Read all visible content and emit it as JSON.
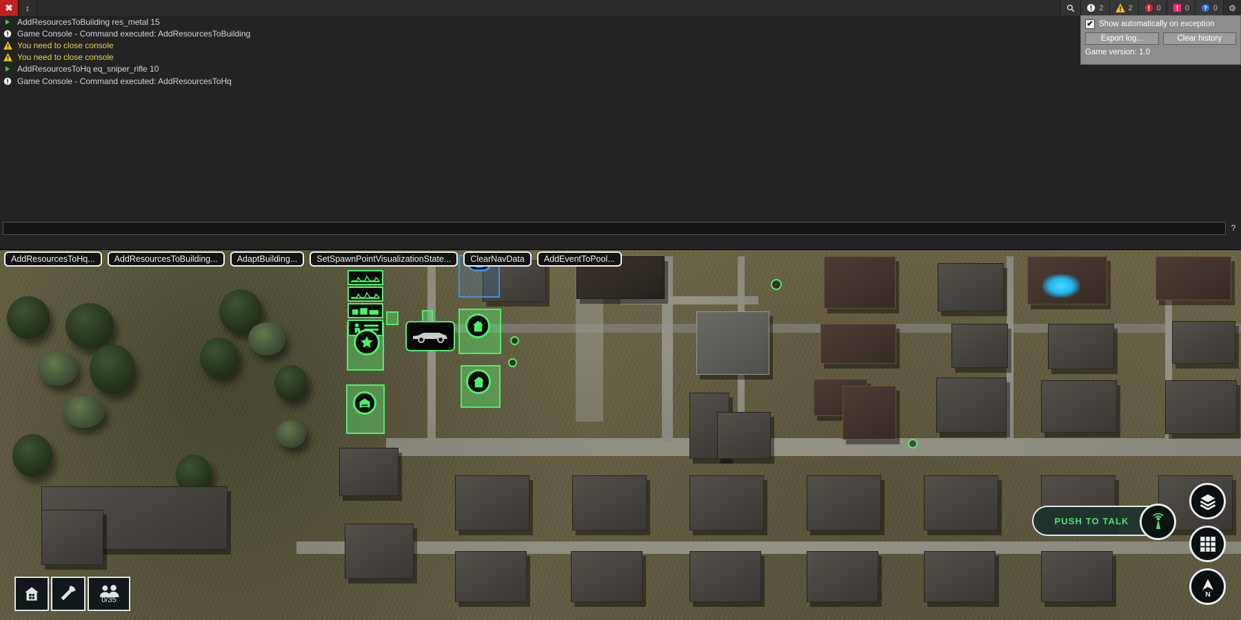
{
  "window": {
    "close_label": "✖",
    "resize_label": "↕",
    "gear_label": "⚙"
  },
  "toolbar": {
    "badges": [
      {
        "name": "search",
        "icon": "search-icon",
        "count": ""
      },
      {
        "name": "info",
        "icon": "info-icon",
        "count": "2"
      },
      {
        "name": "warning",
        "icon": "warning-icon",
        "count": "2"
      },
      {
        "name": "error",
        "icon": "error-icon",
        "count": "0"
      },
      {
        "name": "fatal",
        "icon": "fatal-icon",
        "count": "0"
      },
      {
        "name": "question",
        "icon": "question-icon",
        "count": "0"
      }
    ]
  },
  "console": {
    "log_entries": [
      {
        "icon": "chevron-right-icon",
        "type": "command",
        "text": "AddResourcesToBuilding res_metal 15"
      },
      {
        "icon": "info-icon",
        "type": "info",
        "text": "Game Console - Command executed: AddResourcesToBuilding"
      },
      {
        "icon": "warning-icon",
        "type": "warning",
        "text": "You need to close console"
      },
      {
        "icon": "warning-icon",
        "type": "warning",
        "text": "You need to close console"
      },
      {
        "icon": "chevron-right-icon",
        "type": "command",
        "text": "AddResourcesToHq eq_sniper_rifle 10"
      },
      {
        "icon": "info-icon",
        "type": "info",
        "text": "Game Console - Command executed: AddResourcesToHq"
      }
    ],
    "input_value": "",
    "input_placeholder": "",
    "help_label": "?"
  },
  "quick_commands": [
    {
      "label": "AddResourcesToHq..."
    },
    {
      "label": "AddResourcesToBuilding..."
    },
    {
      "label": "AdaptBuilding..."
    },
    {
      "label": "SetSpawnPointVisualizationState..."
    },
    {
      "label": "ClearNavData"
    },
    {
      "label": "AddEventToPool..."
    }
  ],
  "exception_panel": {
    "checkbox_checked": "✔",
    "checkbox_label": "Show automatically on exception",
    "export_label": "Export log...",
    "clear_label": "Clear history",
    "version_label": "Game version: 1.0"
  },
  "hud": {
    "left_buttons": [
      {
        "name": "build-button",
        "icon": "house-icon",
        "count": ""
      },
      {
        "name": "gather-button",
        "icon": "axe-icon",
        "count": ""
      },
      {
        "name": "population-button",
        "icon": "people-icon",
        "count": "0/35"
      }
    ],
    "push_to_talk": {
      "label": "PUSH TO TALK",
      "icon": "radio-tower-icon"
    },
    "round_buttons": [
      {
        "name": "layers-button",
        "icon": "layers-icon"
      },
      {
        "name": "grid-button",
        "icon": "grid-icon"
      },
      {
        "name": "compass-button",
        "icon": "compass-icon",
        "label": "N"
      }
    ]
  },
  "colors": {
    "friendly": "#4cf06a",
    "enemy_highlight": "#3c92e6",
    "warning": "#e8d24a",
    "terrain": "#6e6a4a",
    "water": "#22b6f0"
  }
}
